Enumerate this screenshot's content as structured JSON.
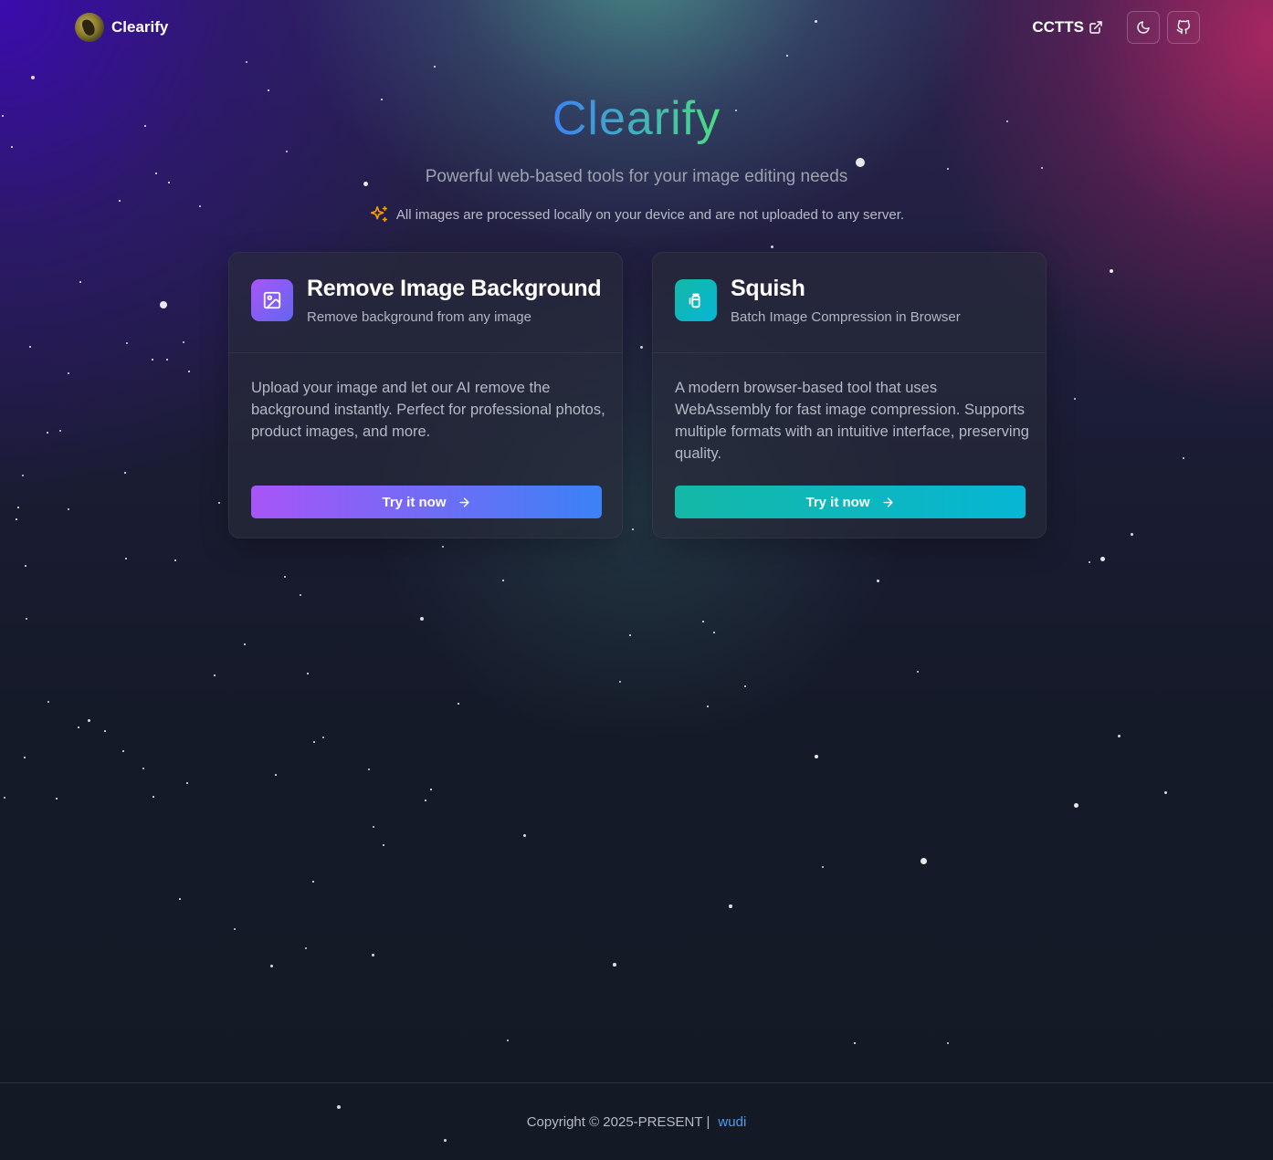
{
  "header": {
    "brand_name": "Clearify",
    "external_link_label": "CCTTS"
  },
  "hero": {
    "title": "Clearify",
    "subtitle": "Powerful web-based tools for your image editing needs",
    "notice": "All images are processed locally on your device and are not uploaded to any server."
  },
  "tools": [
    {
      "title": "Remove Image Background",
      "subtitle": "Remove background from any image",
      "description": "Upload your image and let our AI remove the background instantly. Perfect for professional photos, product images, and more.",
      "button_label": "Try it now",
      "icon": "image-icon"
    },
    {
      "title": "Squish",
      "subtitle": "Batch Image Compression in Browser",
      "description": "A modern browser-based tool that uses WebAssembly for fast image compression. Supports multiple formats with an intuitive interface, preserving quality.",
      "button_label": "Try it now",
      "icon": "squish-icon"
    }
  ],
  "footer": {
    "copyright": "Copyright © 2025-PRESENT",
    "separator": "|",
    "author": "wudi"
  },
  "colors": {
    "accent_purple": "#a855f7",
    "accent_blue": "#3b82f6",
    "accent_teal": "#14b8a6",
    "accent_cyan": "#06b6d4",
    "title_gradient_end": "#4ade80",
    "link_blue": "#4b9bf5",
    "sparkle_orange": "#f59e0b"
  }
}
